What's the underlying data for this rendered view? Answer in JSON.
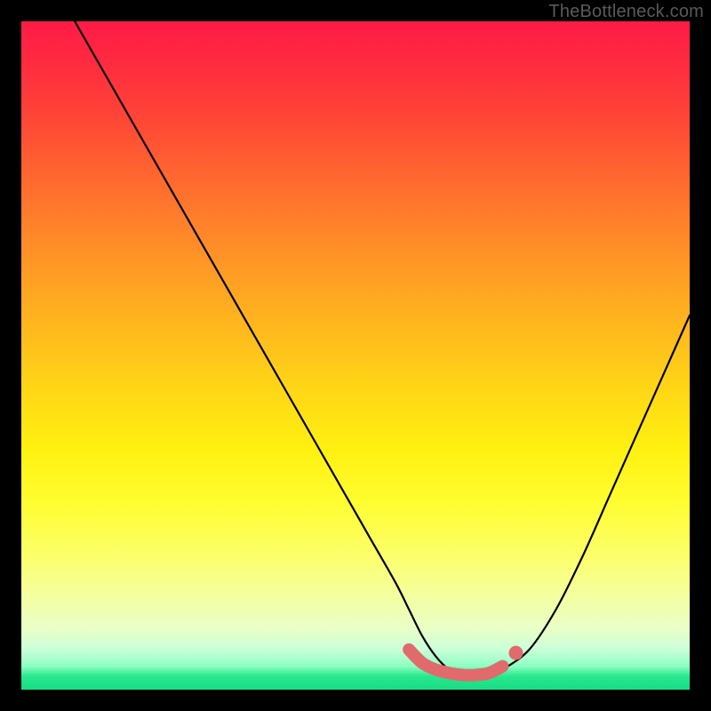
{
  "watermark": "TheBottleneck.com",
  "colors": {
    "curve_stroke": "#000000",
    "valley_stroke": "#e16a6d",
    "valley_dot_fill": "#e16a6d"
  },
  "chart_data": {
    "type": "line",
    "title": "",
    "xlabel": "",
    "ylabel": "",
    "xlim": [
      0,
      100
    ],
    "ylim": [
      0,
      100
    ],
    "series": [
      {
        "name": "bottleneck-curve",
        "x": [
          8,
          12,
          16,
          20,
          24,
          28,
          32,
          36,
          40,
          44,
          48,
          52,
          56,
          58,
          60,
          62,
          64,
          66,
          68,
          70,
          72,
          76,
          80,
          84,
          88,
          92,
          96,
          100
        ],
        "y": [
          100,
          93,
          86,
          79,
          72,
          65,
          58,
          51,
          44,
          37,
          30,
          23,
          16,
          12,
          8,
          5,
          3,
          2,
          2,
          2,
          3,
          6,
          12,
          20,
          29,
          38,
          47,
          56
        ]
      }
    ],
    "valley": {
      "x_start": 58,
      "x_end": 72,
      "points_x": [
        58,
        60,
        62,
        64,
        66,
        68,
        70,
        72
      ],
      "points_y": [
        6,
        4,
        3,
        2.5,
        2.2,
        2.2,
        2.5,
        3.5
      ]
    }
  }
}
